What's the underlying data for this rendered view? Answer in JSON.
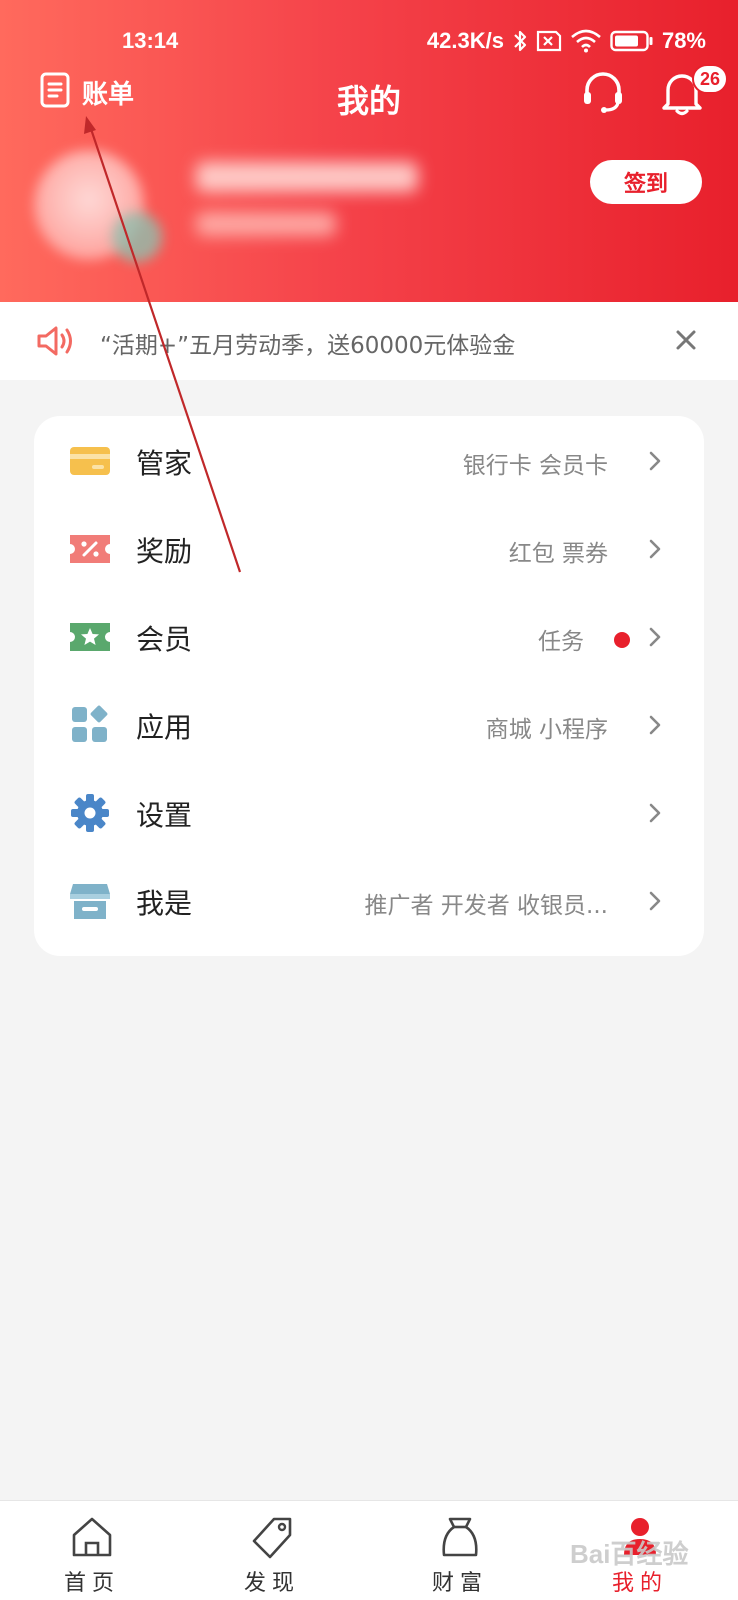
{
  "status_bar": {
    "time": "13:14",
    "speed": "42.3K/s",
    "battery": "78%",
    "battery_level": 0.78
  },
  "topnav": {
    "bill_label": "账单",
    "title": "我的",
    "badge_count": "26"
  },
  "profile": {
    "signin_label": "签到"
  },
  "notice": {
    "text": "“活期+”五月劳动季，送60000元体验金"
  },
  "menu": [
    {
      "icon": "card-icon",
      "label": "管家",
      "desc": "银行卡 会员卡",
      "color": "#f6c04d"
    },
    {
      "icon": "coupon-icon",
      "label": "奖励",
      "desc": "红包 票券",
      "color": "#f17c78"
    },
    {
      "icon": "ticket-star-icon",
      "label": "会员",
      "desc": "任务",
      "color": "#5aa86d",
      "has_dot": true
    },
    {
      "icon": "apps-icon",
      "label": "应用",
      "desc": "商城 小程序",
      "color": "#7fb2c9"
    },
    {
      "icon": "gear-icon",
      "label": "设置",
      "desc": "",
      "color": "#4a86c8"
    },
    {
      "icon": "store-icon",
      "label": "我是",
      "desc": "推广者 开发者 收银员...",
      "color": "#7fb2c9"
    }
  ],
  "tabbar": [
    {
      "icon": "home-icon",
      "label": "首页"
    },
    {
      "icon": "tag-icon",
      "label": "发现"
    },
    {
      "icon": "wealth-jar-icon",
      "label": "财富"
    },
    {
      "icon": "user-icon",
      "label": "我的",
      "active": true
    }
  ],
  "colors": {
    "brand": "#e8202c",
    "header_start": "#ff6a5d",
    "header_end": "#e8202c"
  },
  "watermark": "Bai百经验"
}
